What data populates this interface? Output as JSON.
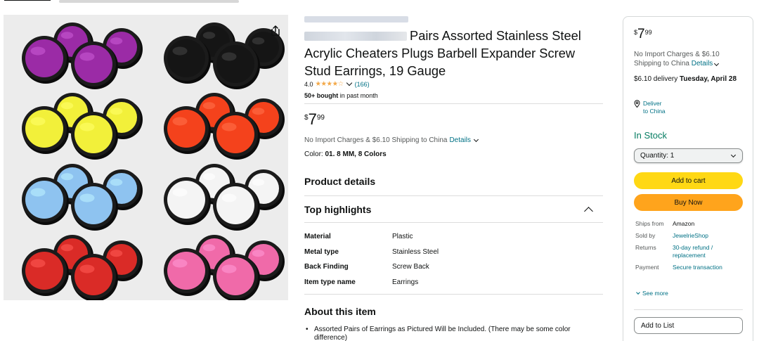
{
  "product": {
    "title_rest": "Pairs Assorted Stainless Steel Acrylic Cheaters Plugs Barbell Expander Screw Stud Earrings, 19 Gauge",
    "rating_value": "4.0",
    "stars": "★★★★☆",
    "rating_count": "(166)",
    "bought_bold": "50+ bought",
    "bought_rest": " in past month",
    "price_currency": "$",
    "price_whole": "7",
    "price_fraction": "99",
    "shipping_text": "No Import Charges & $6.10 Shipping to China",
    "details_link": "Details",
    "color_label": "Color:",
    "color_value": "01. 8 MM, 8 Colors",
    "image_colors": [
      "#9b2ba6",
      "#151515",
      "#f2f03a",
      "#f4421c",
      "#8ec3f0",
      "#f4f4f4",
      "#da2b27",
      "#f06aa9"
    ]
  },
  "sections": {
    "product_details": "Product details",
    "top_highlights": "Top highlights",
    "about": "About this item"
  },
  "specs": [
    {
      "key": "Material",
      "value": "Plastic"
    },
    {
      "key": "Metal type",
      "value": "Stainless Steel"
    },
    {
      "key": "Back Finding",
      "value": "Screw Back"
    },
    {
      "key": "Item type name",
      "value": "Earrings"
    }
  ],
  "about_bullets": [
    "Assorted Pairs of Earrings as Pictured Will be Included. (There may be some color difference)"
  ],
  "buybox": {
    "currency": "$",
    "whole": "7",
    "fraction": "99",
    "shipping_text": "No Import Charges & $6.10 Shipping to China",
    "details_link": "Details",
    "delivery_text": "$6.10 delivery",
    "delivery_date": "Tuesday, April 28",
    "deliver_line1": "Deliver",
    "deliver_line2": "to China",
    "stock": "In Stock",
    "quantity": "Quantity: 1",
    "add_to_cart": "Add to cart",
    "buy_now": "Buy Now",
    "info": [
      {
        "key": "Ships from",
        "value": "Amazon",
        "link": false
      },
      {
        "key": "Sold by",
        "value": "JewelrieShop",
        "link": true
      },
      {
        "key": "Returns",
        "value": "30-day refund / replacement",
        "link": true
      },
      {
        "key": "Payment",
        "value": "Secure transaction",
        "link": true
      }
    ],
    "see_more": "See more",
    "add_to_list": "Add to List"
  },
  "colors": {
    "link": "#007185",
    "in_stock": "#067d62",
    "add_to_cart": "#ffd814",
    "buy_now": "#ffa41c",
    "star": "#f3a847"
  }
}
